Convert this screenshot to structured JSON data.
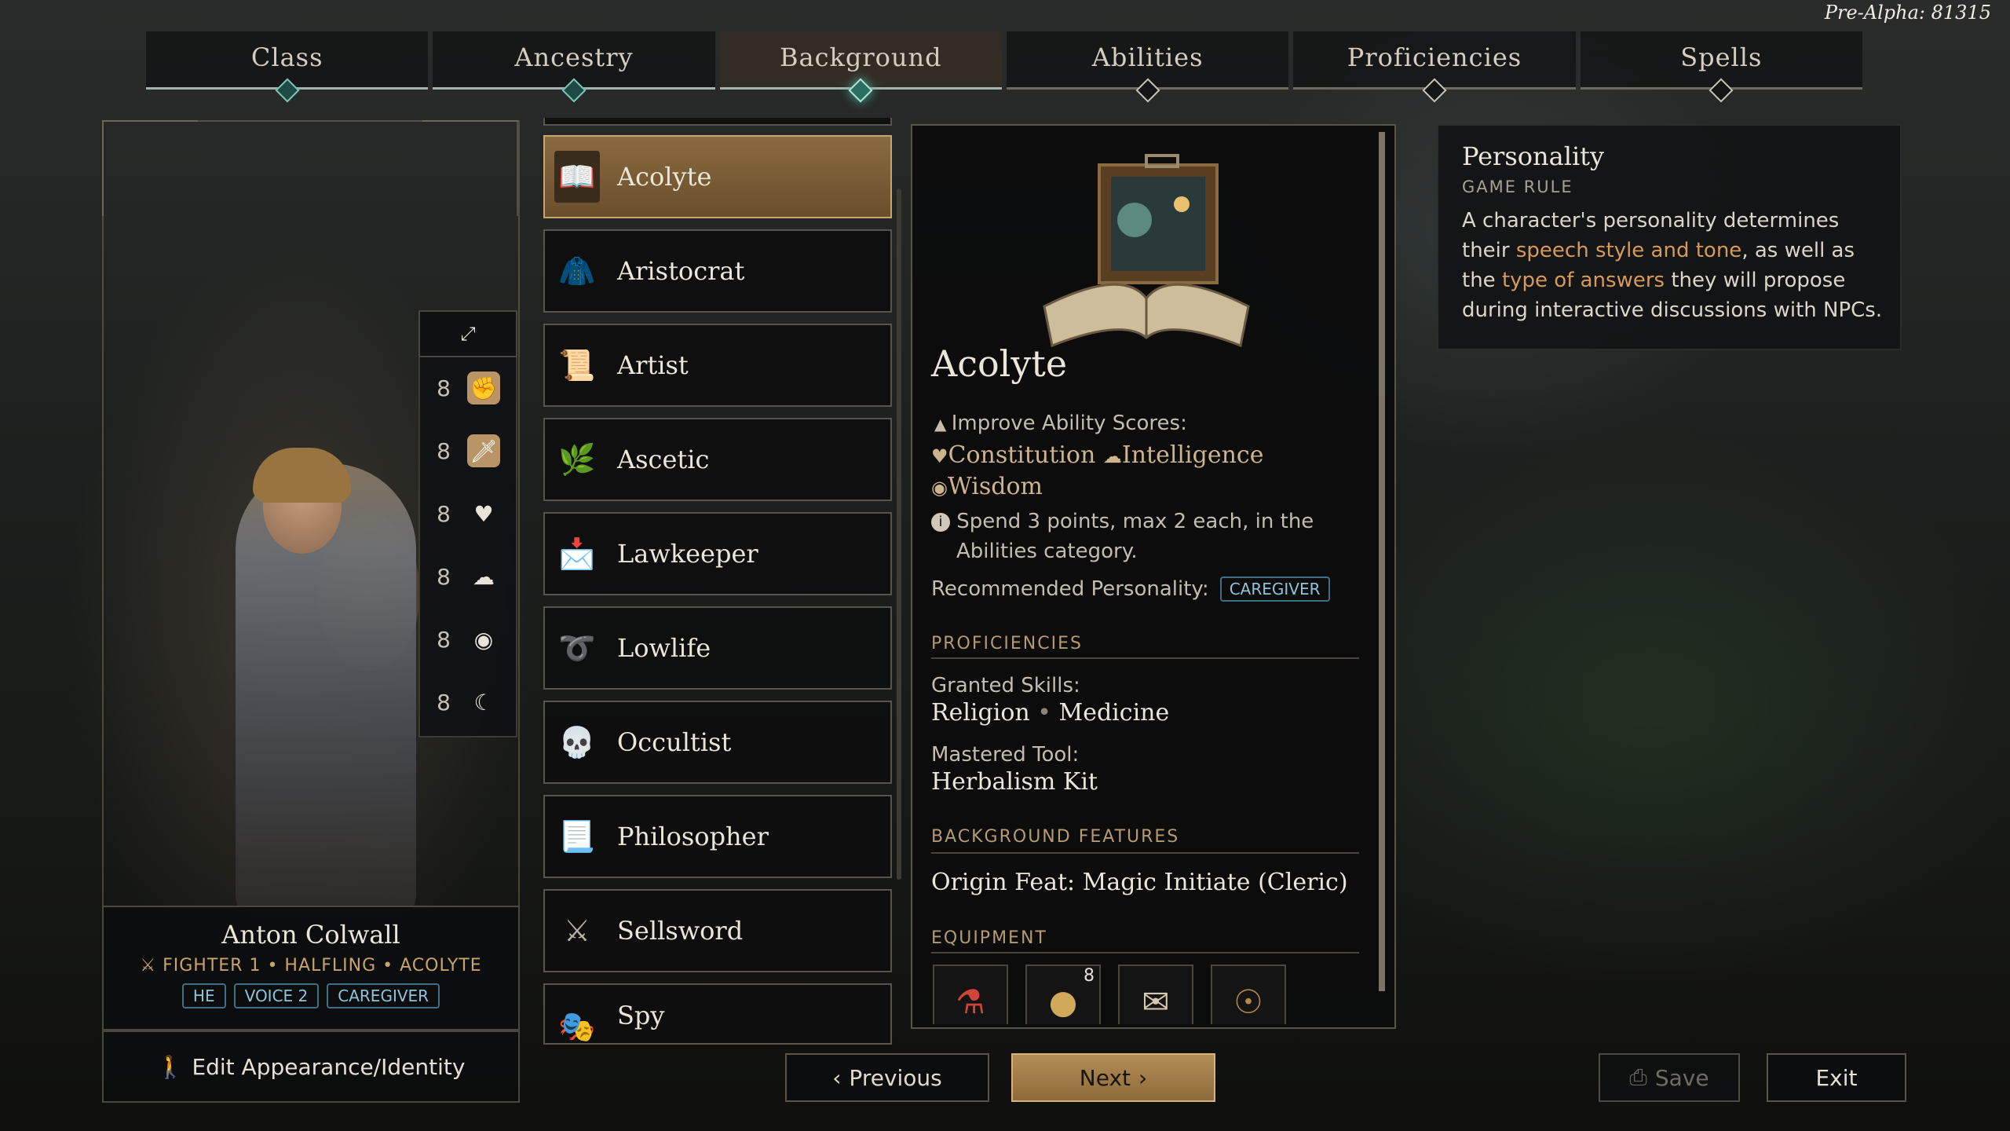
{
  "build": "Pre-Alpha: 81315",
  "tabs": [
    {
      "label": "Class",
      "state": "done"
    },
    {
      "label": "Ancestry",
      "state": "done"
    },
    {
      "label": "Background",
      "state": "active"
    },
    {
      "label": "Abilities",
      "state": "pending"
    },
    {
      "label": "Proficiencies",
      "state": "pending"
    },
    {
      "label": "Spells",
      "state": "pending"
    }
  ],
  "stats": [
    {
      "value": "8",
      "icon": "fist-icon",
      "highlight": true
    },
    {
      "value": "8",
      "icon": "dagger-icon",
      "highlight": true
    },
    {
      "value": "8",
      "icon": "heart-icon",
      "highlight": false
    },
    {
      "value": "8",
      "icon": "brain-icon",
      "highlight": false
    },
    {
      "value": "8",
      "icon": "eye-icon",
      "highlight": false
    },
    {
      "value": "8",
      "icon": "charisma-icon",
      "highlight": false
    }
  ],
  "character": {
    "name": "Anton Colwall",
    "info": "FIGHTER 1 • HALFLING • ACOLYTE",
    "tags": [
      "HE",
      "VOICE 2",
      "CAREGIVER"
    ],
    "edit_label": "Edit Appearance/Identity"
  },
  "backgrounds": [
    {
      "name": "Acolyte",
      "selected": true,
      "icon": "book-icon"
    },
    {
      "name": "Aristocrat",
      "selected": false,
      "icon": "noble-icon"
    },
    {
      "name": "Artist",
      "selected": false,
      "icon": "scroll-icon"
    },
    {
      "name": "Ascetic",
      "selected": false,
      "icon": "herb-icon"
    },
    {
      "name": "Lawkeeper",
      "selected": false,
      "icon": "seal-icon"
    },
    {
      "name": "Lowlife",
      "selected": false,
      "icon": "rope-icon"
    },
    {
      "name": "Occultist",
      "selected": false,
      "icon": "skull-icon"
    },
    {
      "name": "Philosopher",
      "selected": false,
      "icon": "parchment-icon"
    },
    {
      "name": "Sellsword",
      "selected": false,
      "icon": "sword-icon"
    },
    {
      "name": "Spy",
      "selected": false,
      "icon": "mask-icon"
    }
  ],
  "detail": {
    "title": "Acolyte",
    "improve_label": "Improve Ability Scores:",
    "abilities": [
      "Constitution",
      "Intelligence",
      "Wisdom"
    ],
    "spend_text_1": "Spend 3 points, max 2 each, in the",
    "spend_text_2": "Abilities category.",
    "recommended_label": "Recommended Personality:",
    "recommended_value": "CAREGIVER",
    "proficiencies_header": "PROFICIENCIES",
    "granted_label": "Granted Skills:",
    "skill_1": "Religion",
    "skill_2": "Medicine",
    "tool_label": "Mastered Tool:",
    "tool": "Herbalism Kit",
    "features_header": "BACKGROUND FEATURES",
    "feature": "Origin Feat: Magic Initiate (Cleric)",
    "equipment_header": "EQUIPMENT",
    "equipment": [
      {
        "icon": "potion-icon",
        "count": ""
      },
      {
        "icon": "coin-icon",
        "count": "8"
      },
      {
        "icon": "letter-icon",
        "count": ""
      },
      {
        "icon": "amulet-icon",
        "count": ""
      }
    ]
  },
  "tooltip": {
    "title": "Personality",
    "subtitle": "GAME RULE",
    "line1": "A character's personality determines",
    "line2_a": "their ",
    "line2_hl": "speech style and tone",
    "line2_b": ", as well as",
    "line3_a": "the ",
    "line3_hl": "type of answers",
    "line3_b": " they will propose",
    "line4": "during interactive discussions with NPCs."
  },
  "buttons": {
    "previous": "Previous",
    "next": "Next",
    "save": "Save",
    "exit": "Exit"
  },
  "colors": {
    "accent_gold": "#b38d55",
    "teal_progress": "#4fb7a3",
    "tag_blue": "#8fc3db",
    "highlight_orange": "#d79a57"
  }
}
